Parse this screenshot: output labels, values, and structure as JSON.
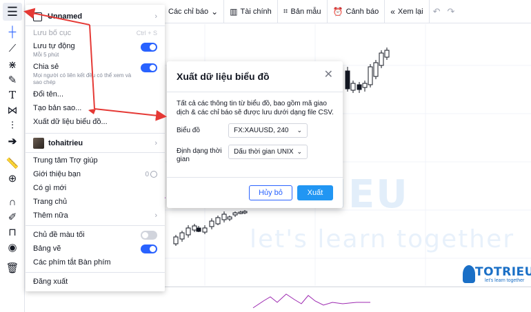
{
  "top_toolbar": {
    "items": [
      {
        "label": "Các chỉ báo",
        "icon": "chevron-down-icon"
      },
      {
        "label": "Tài chính",
        "icon": "bar-chart-icon"
      },
      {
        "label": "Bản mẫu",
        "icon": "template-icon"
      },
      {
        "label": "Cảnh báo",
        "icon": "alarm-icon"
      },
      {
        "label": "Xem lại",
        "icon": "replay-icon"
      }
    ],
    "undo_icon": "undo-icon",
    "redo_icon": "redo-icon"
  },
  "left_toolbar": {
    "icons": [
      "menu-icon",
      "crosshair-icon",
      "trend-line-icon",
      "fib-icon",
      "brush-icon",
      "text-icon",
      "pattern-icon",
      "forecast-icon",
      "arrow-icon",
      "ruler-icon",
      "zoom-icon",
      "magnet-icon",
      "lock-draw-icon",
      "lock-icon",
      "eye-icon",
      "trash-icon"
    ],
    "text_glyph": "T"
  },
  "menu": {
    "layout_name": "Unnamed",
    "save_layout": "Lưu bố cục",
    "save_shortcut": "Ctrl + S",
    "autosave": "Lưu tự động",
    "autosave_sub": "Mỗi 5 phút",
    "share": "Chia sẻ",
    "share_sub": "Mọi người có liên kết đều có thể xem và sao chép",
    "rename": "Đổi tên...",
    "copy": "Tạo bản sao...",
    "export": "Xuất dữ liệu biểu đồ...",
    "username": "tohaitrieu",
    "help": "Trung tâm Trợ giúp",
    "refer": "Giới thiệu bạn",
    "refer_count": "0",
    "whats_new": "Có gì mới",
    "home": "Trang chủ",
    "more": "Thêm nữa",
    "dark_theme": "Chủ đề màu tối",
    "drawing_panel": "Bảng vẽ",
    "shortcuts": "Các phím tắt Bàn phím",
    "logout": "Đăng xuất"
  },
  "dialog": {
    "title": "Xuất dữ liệu biểu đồ",
    "description": "Tất cả các thông tin từ biểu đồ, bao gồm mã giao dịch & các chỉ báo sẽ được lưu dưới dạng file CSV.",
    "chart_label": "Biểu đồ",
    "chart_value": "FX:XAUUSD, 240",
    "time_format_label": "Định dạng thời gian",
    "time_format_value": "Dấu thời gian UNIX",
    "cancel": "Hủy bỏ",
    "export": "Xuất"
  },
  "watermark": {
    "big": "TOTRIEU",
    "sub": "let's learn together",
    "logo": "TOTRIEU",
    "logo_sub": "let's learn together"
  },
  "colors": {
    "accent": "#2962ff",
    "annotation_red": "#e53935",
    "up_candle": "#ffffff",
    "down_candle": "#000000",
    "indicator": "#9c27b0"
  }
}
